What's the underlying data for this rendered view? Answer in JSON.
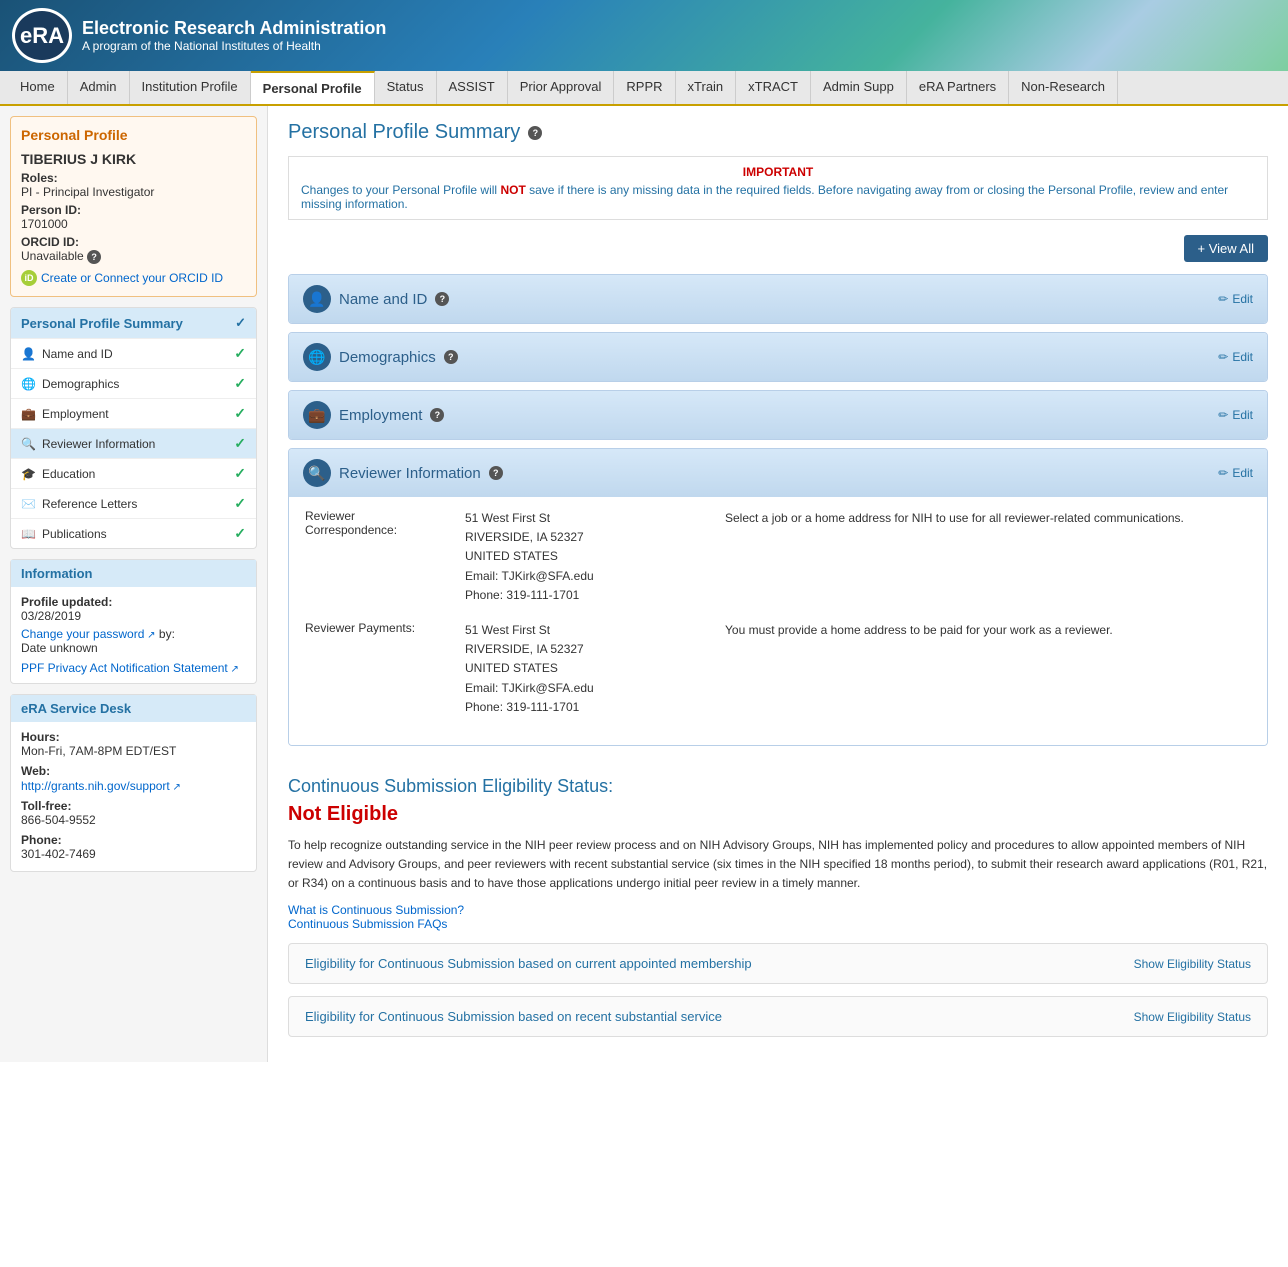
{
  "header": {
    "logo_text": "eRA",
    "title": "Electronic Research Administration",
    "subtitle": "A program of the National Institutes of Health"
  },
  "nav": {
    "items": [
      {
        "label": "Home",
        "active": false
      },
      {
        "label": "Admin",
        "active": false
      },
      {
        "label": "Institution Profile",
        "active": false
      },
      {
        "label": "Personal Profile",
        "active": true
      },
      {
        "label": "Status",
        "active": false
      },
      {
        "label": "ASSIST",
        "active": false
      },
      {
        "label": "Prior Approval",
        "active": false
      },
      {
        "label": "RPPR",
        "active": false
      },
      {
        "label": "xTrain",
        "active": false
      },
      {
        "label": "xTRACT",
        "active": false
      },
      {
        "label": "Admin Supp",
        "active": false
      },
      {
        "label": "eRA Partners",
        "active": false
      },
      {
        "label": "Non-Research",
        "active": false
      }
    ]
  },
  "sidebar": {
    "profile_box": {
      "title": "Personal Profile",
      "name": "TIBERIUS J KIRK",
      "roles_label": "Roles:",
      "roles_value": "PI - Principal Investigator",
      "person_id_label": "Person ID:",
      "person_id_value": "1701000",
      "orcid_label": "ORCID ID:",
      "orcid_value": "Unavailable",
      "orcid_link": "Create or Connect your ORCID ID"
    },
    "profile_summary": {
      "header": "Personal Profile Summary",
      "items": [
        {
          "label": "Name and ID",
          "icon": "person",
          "checked": true
        },
        {
          "label": "Demographics",
          "icon": "globe",
          "checked": true
        },
        {
          "label": "Employment",
          "icon": "briefcase",
          "checked": true
        },
        {
          "label": "Reviewer Information",
          "icon": "search",
          "checked": true,
          "active": true
        },
        {
          "label": "Education",
          "icon": "graduation-cap",
          "checked": true
        },
        {
          "label": "Reference Letters",
          "icon": "envelope",
          "checked": true
        },
        {
          "label": "Publications",
          "icon": "book",
          "checked": true
        }
      ]
    },
    "information": {
      "header": "Information",
      "profile_updated_label": "Profile updated:",
      "profile_updated_value": "03/28/2019",
      "change_password_label": "Change your password",
      "change_password_by": "by:",
      "date_unknown": "Date unknown",
      "ppf_link": "PPF Privacy Act Notification Statement"
    },
    "service_desk": {
      "header": "eRA Service Desk",
      "hours_label": "Hours:",
      "hours_value": "Mon-Fri, 7AM-8PM EDT/EST",
      "web_label": "Web:",
      "web_value": "http://grants.nih.gov/support",
      "tollfree_label": "Toll-free:",
      "tollfree_value": "866-504-9552",
      "phone_label": "Phone:",
      "phone_value": "301-402-7469"
    }
  },
  "main": {
    "page_title": "Personal Profile Summary",
    "view_all_button": "+ View All",
    "important": {
      "label": "IMPORTANT",
      "text_before": "Changes to your Personal Profile will ",
      "text_bold": "NOT",
      "text_after": " save if there is any missing data in the required fields. Before navigating away from or closing the Personal Profile, review and enter missing information."
    },
    "sections": [
      {
        "id": "name-and-id",
        "title": "Name and ID",
        "icon": "person",
        "edit_label": "Edit",
        "has_body": false
      },
      {
        "id": "demographics",
        "title": "Demographics",
        "icon": "globe",
        "edit_label": "Edit",
        "has_body": false
      },
      {
        "id": "employment",
        "title": "Employment",
        "icon": "briefcase",
        "edit_label": "Edit",
        "has_body": false
      },
      {
        "id": "reviewer-information",
        "title": "Reviewer Information",
        "icon": "search",
        "edit_label": "Edit",
        "has_body": true,
        "rows": [
          {
            "label": "Reviewer Correspondence:",
            "address_line1": "51  West First St",
            "address_line2": "RIVERSIDE, IA 52327",
            "address_line3": "UNITED STATES",
            "address_email": "Email: TJKirk@SFA.edu",
            "address_phone": "Phone: 319-111-1701",
            "note": "Select a job or a home address for NIH to use for all reviewer-related communications."
          },
          {
            "label": "Reviewer Payments:",
            "address_line1": "51  West First St",
            "address_line2": "RIVERSIDE, IA 52327",
            "address_line3": "UNITED STATES",
            "address_email": "Email: TJKirk@SFA.edu",
            "address_phone": "Phone: 319-111-1701",
            "note": "You must provide a home address to be paid for your work as a reviewer."
          }
        ]
      }
    ],
    "continuous_submission": {
      "title": "Continuous Submission Eligibility Status:",
      "status": "Not Eligible",
      "description": "To help recognize outstanding service in the NIH peer review process and on NIH Advisory Groups, NIH has implemented policy and procedures to allow appointed members of NIH review and Advisory Groups, and peer reviewers with recent substantial service (six times in the NIH specified 18 months period), to submit their research award applications (R01, R21, or R34) on a continuous basis and to have those applications undergo initial peer review in a timely manner.",
      "link1": "What is Continuous Submission?",
      "link2": "Continuous Submission FAQs",
      "eligibility_rows": [
        {
          "text": "Eligibility for Continuous Submission based on current appointed membership",
          "link": "Show Eligibility Status"
        },
        {
          "text": "Eligibility for Continuous Submission based on recent substantial service",
          "link": "Show Eligibility Status"
        }
      ]
    }
  }
}
